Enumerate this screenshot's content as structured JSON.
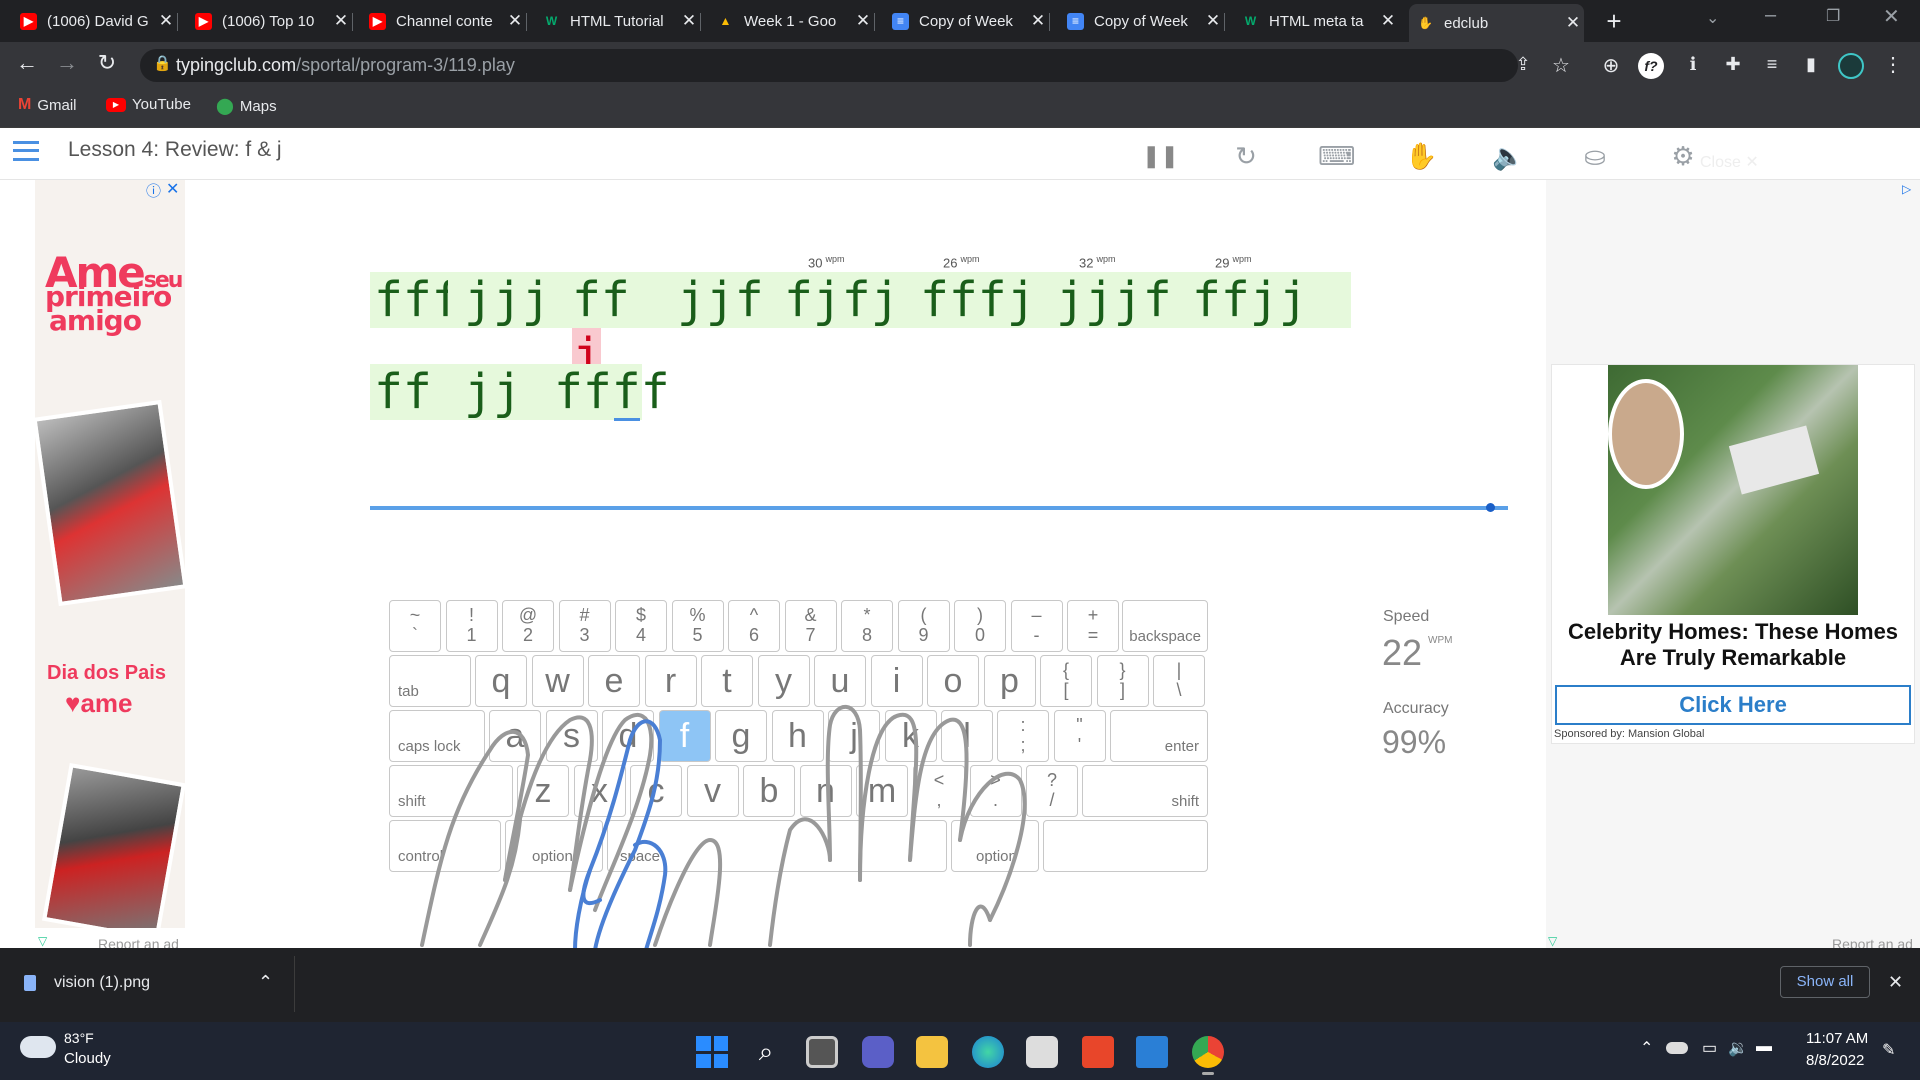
{
  "browser": {
    "tabs": [
      {
        "title": "(1006) David G",
        "icon": "youtube-icon"
      },
      {
        "title": "(1006) Top 10",
        "icon": "youtube-icon"
      },
      {
        "title": "Channel conte",
        "icon": "youtube-icon"
      },
      {
        "title": "HTML Tutorial",
        "icon": "w3schools-icon"
      },
      {
        "title": "Week 1 - Goo",
        "icon": "google-drive-icon"
      },
      {
        "title": "Copy of Week",
        "icon": "google-docs-icon"
      },
      {
        "title": "Copy of Week",
        "icon": "google-docs-icon"
      },
      {
        "title": "HTML meta ta",
        "icon": "w3schools-icon"
      },
      {
        "title": "edclub",
        "icon": "edclub-icon"
      }
    ],
    "active_tab": 8,
    "url_host": "typingclub.com",
    "url_path": "/sportal/program-3/119.play",
    "bookmarks": [
      {
        "label": "Gmail",
        "icon": "gmail-icon"
      },
      {
        "label": "YouTube",
        "icon": "youtube-icon"
      },
      {
        "label": "Maps",
        "icon": "maps-icon"
      }
    ]
  },
  "lesson": {
    "title": "Lesson 4: Review: f & j",
    "close_label": "Close",
    "line1": [
      {
        "text": "fff"
      },
      {
        "text": "jjj"
      },
      {
        "text_before": "ff",
        "error_char": "j"
      },
      {
        "text": "jjf",
        "wpm": "30"
      },
      {
        "text": "fjfj",
        "wpm": "26"
      },
      {
        "text": "fffj",
        "wpm": "32"
      },
      {
        "text": "jjjf",
        "wpm": "29"
      },
      {
        "text": "ffjj"
      }
    ],
    "wpm_unit": "wpm",
    "line2": [
      "ff",
      "jj",
      "ffff"
    ],
    "progress": 1.0
  },
  "keyboard": {
    "row1": [
      [
        "~",
        "`"
      ],
      [
        "!",
        "1"
      ],
      [
        "@",
        "2"
      ],
      [
        "#",
        "3"
      ],
      [
        "$",
        "4"
      ],
      [
        "%",
        "5"
      ],
      [
        "^",
        "6"
      ],
      [
        "&",
        "7"
      ],
      [
        "*",
        "8"
      ],
      [
        "(",
        "9"
      ],
      [
        ")",
        "0"
      ],
      [
        "–",
        "-"
      ],
      [
        "+",
        "="
      ]
    ],
    "backspace": "backspace",
    "tab": "tab",
    "row2": [
      "q",
      "w",
      "e",
      "r",
      "t",
      "y",
      "u",
      "i",
      "o",
      "p"
    ],
    "row2_pairs": [
      [
        "{",
        "["
      ],
      [
        "}",
        "]"
      ],
      [
        "|",
        "\\"
      ]
    ],
    "caps": "caps lock",
    "row3": [
      "a",
      "s",
      "d",
      "f",
      "g",
      "h",
      "j",
      "k",
      "l"
    ],
    "row3_pairs": [
      [
        ":",
        ";"
      ],
      [
        "\"",
        "'"
      ]
    ],
    "enter": "enter",
    "shift": "shift",
    "row4": [
      "z",
      "x",
      "c",
      "v",
      "b",
      "n",
      "m"
    ],
    "row4_pairs": [
      [
        "<",
        ","
      ],
      [
        ">",
        "."
      ],
      [
        "?",
        "/"
      ]
    ],
    "control": "control",
    "option": "option",
    "space": "space",
    "highlight_key": "f",
    "highlight_color": "#8ec5f5"
  },
  "stats": {
    "speed_label": "Speed",
    "speed_value": "22",
    "speed_unit": "WPM",
    "accuracy_label": "Accuracy",
    "accuracy_value": "99%"
  },
  "ads": {
    "left_brand": "Ame",
    "left_tag1": "seu",
    "left_tag2": "primeiro",
    "left_tag3": "amigo",
    "left_promo": "Dia dos Pais",
    "left_brand2": "ame",
    "report_label": "Report an ad",
    "right_headline": "Celebrity Homes: These Homes Are Truly Remarkable",
    "right_cta": "Click Here",
    "right_sponsor": "Sponsored by: Mansion Global",
    "right_report": "Report an ad"
  },
  "downloads": {
    "file": "vision (1).png",
    "show_all": "Show all"
  },
  "taskbar": {
    "temp": "83°F",
    "weather": "Cloudy",
    "time": "11:07 AM",
    "date": "8/8/2022"
  },
  "colors": {
    "chunk_bg": "#e6f9dc",
    "chunk_text": "#1a5e1a",
    "error_bg": "#f9c9cf",
    "error_text": "#d0021b",
    "accent": "#4a90e2"
  }
}
